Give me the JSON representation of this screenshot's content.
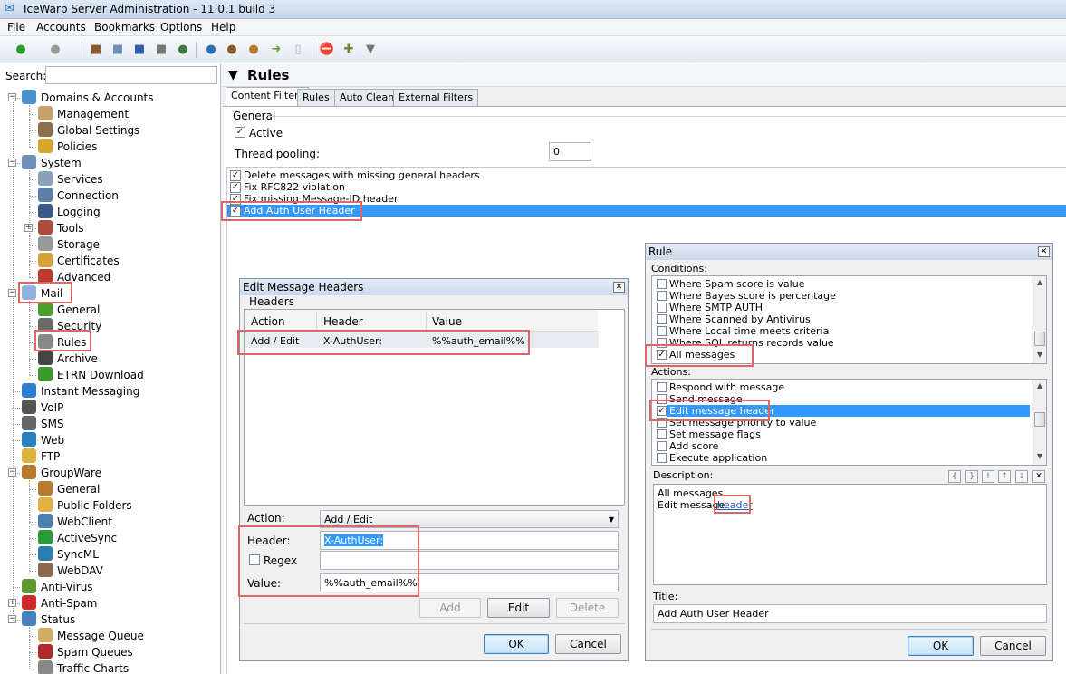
{
  "window": {
    "title": "IceWarp Server Administration - 11.0.1 build 3"
  },
  "menu": [
    "File",
    "Accounts",
    "Bookmarks",
    "Options",
    "Help"
  ],
  "search": {
    "label": "Search:",
    "value": ""
  },
  "tree": [
    {
      "label": "Domains & Accounts",
      "icon": "globe-icon"
    },
    {
      "label": "Management",
      "icon": "management-icon"
    },
    {
      "label": "Global Settings",
      "icon": "settings-icon"
    },
    {
      "label": "Policies",
      "icon": "lock-icon"
    },
    {
      "label": "System",
      "icon": "computer-icon"
    },
    {
      "label": "Services",
      "icon": "services-icon"
    },
    {
      "label": "Connection",
      "icon": "connection-icon"
    },
    {
      "label": "Logging",
      "icon": "log-icon"
    },
    {
      "label": "Tools",
      "icon": "tools-icon"
    },
    {
      "label": "Storage",
      "icon": "storage-icon"
    },
    {
      "label": "Certificates",
      "icon": "certificate-icon"
    },
    {
      "label": "Advanced",
      "icon": "advanced-icon"
    },
    {
      "label": "Mail",
      "icon": "mail-icon"
    },
    {
      "label": "General",
      "icon": "arrow-icon"
    },
    {
      "label": "Security",
      "icon": "shield-icon"
    },
    {
      "label": "Rules",
      "icon": "filter-icon"
    },
    {
      "label": "Archive",
      "icon": "archive-icon"
    },
    {
      "label": "ETRN Download",
      "icon": "download-icon"
    },
    {
      "label": "Instant Messaging",
      "icon": "chat-icon"
    },
    {
      "label": "VoIP",
      "icon": "headset-icon"
    },
    {
      "label": "SMS",
      "icon": "phone-icon"
    },
    {
      "label": "Web",
      "icon": "web-icon"
    },
    {
      "label": "FTP",
      "icon": "folder-icon"
    },
    {
      "label": "GroupWare",
      "icon": "groupware-icon"
    },
    {
      "label": "General",
      "icon": "general-icon"
    },
    {
      "label": "Public Folders",
      "icon": "folder-icon"
    },
    {
      "label": "WebClient",
      "icon": "webclient-icon"
    },
    {
      "label": "ActiveSync",
      "icon": "sync-icon"
    },
    {
      "label": "SyncML",
      "icon": "syncml-icon"
    },
    {
      "label": "WebDAV",
      "icon": "webdav-icon"
    },
    {
      "label": "Anti-Virus",
      "icon": "antivirus-icon"
    },
    {
      "label": "Anti-Spam",
      "icon": "antispam-icon"
    },
    {
      "label": "Status",
      "icon": "monitor-icon"
    },
    {
      "label": "Message Queue",
      "icon": "queue-icon"
    },
    {
      "label": "Spam Queues",
      "icon": "spam-queue-icon"
    },
    {
      "label": "Traffic Charts",
      "icon": "chart-icon"
    }
  ],
  "header": {
    "title": "Rules"
  },
  "tabs": [
    "Content Filters",
    "Rules",
    "Auto Clean",
    "External Filters"
  ],
  "general": {
    "label": "General",
    "active_label": "Active",
    "thread_label": "Thread pooling:",
    "thread_value": "0"
  },
  "filters": [
    {
      "label": "Delete messages with missing general headers",
      "checked": true
    },
    {
      "label": "Fix RFC822 violation",
      "checked": true
    },
    {
      "label": "Fix missing Message-ID header",
      "checked": true
    },
    {
      "label": "Add Auth User Header",
      "checked": true
    }
  ],
  "edit_dialog": {
    "title": "Edit Message Headers",
    "group": "Headers",
    "columns": [
      "Action",
      "Header",
      "Value"
    ],
    "row": {
      "action": "Add / Edit",
      "header": "X-AuthUser:",
      "value": "%%auth_email%%"
    },
    "action_label": "Action:",
    "action_value": "Add / Edit",
    "header_label": "Header:",
    "header_value": "X-AuthUser:",
    "regex_label": "Regex",
    "value_label": "Value:",
    "value_value": "%%auth_email%%",
    "add": "Add",
    "edit": "Edit",
    "delete": "Delete",
    "ok": "OK",
    "cancel": "Cancel"
  },
  "rule_dialog": {
    "title": "Rule",
    "conditions_label": "Conditions:",
    "conditions": [
      {
        "label": "Where Spam score is value",
        "checked": false
      },
      {
        "label": "Where Bayes score is percentage",
        "checked": false
      },
      {
        "label": "Where SMTP AUTH",
        "checked": false
      },
      {
        "label": "Where Scanned by Antivirus",
        "checked": false
      },
      {
        "label": "Where Local time meets criteria",
        "checked": false
      },
      {
        "label": "Where SQL returns records value",
        "checked": false
      },
      {
        "label": "All messages",
        "checked": true
      }
    ],
    "actions_label": "Actions:",
    "actions": [
      {
        "label": "Respond with message",
        "checked": false
      },
      {
        "label": "Send message",
        "checked": false
      },
      {
        "label": "Edit message header",
        "checked": true
      },
      {
        "label": "Set message priority to value",
        "checked": false
      },
      {
        "label": "Set message flags",
        "checked": false
      },
      {
        "label": "Add score",
        "checked": false
      },
      {
        "label": "Execute application",
        "checked": false
      }
    ],
    "description_label": "Description:",
    "desc_line1": "All messages",
    "desc_line2": "Edit message",
    "desc_link": "header",
    "title_label": "Title:",
    "title_value": "Add Auth User Header",
    "ok": "OK",
    "cancel": "Cancel"
  },
  "colors": {
    "selection": "#3399ff",
    "highlight_box": "#e06666",
    "link": "#1a5bb8"
  }
}
